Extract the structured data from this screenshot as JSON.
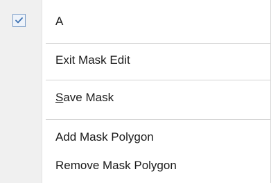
{
  "menu": {
    "items": [
      {
        "label": "A",
        "checked": true
      },
      {
        "label": "Exit Mask Edit"
      },
      {
        "label_mnemonic": "S",
        "label_rest": "ave Mask"
      },
      {
        "label": "Add Mask Polygon"
      },
      {
        "label": "Remove Mask Polygon"
      }
    ]
  },
  "colors": {
    "gutter": "#f0f0f0",
    "separator": "#d2d2d2",
    "checkbox_border": "#7a9cc6",
    "check_mark": "#3a6fb0"
  },
  "icons": {
    "check": "check-icon"
  }
}
